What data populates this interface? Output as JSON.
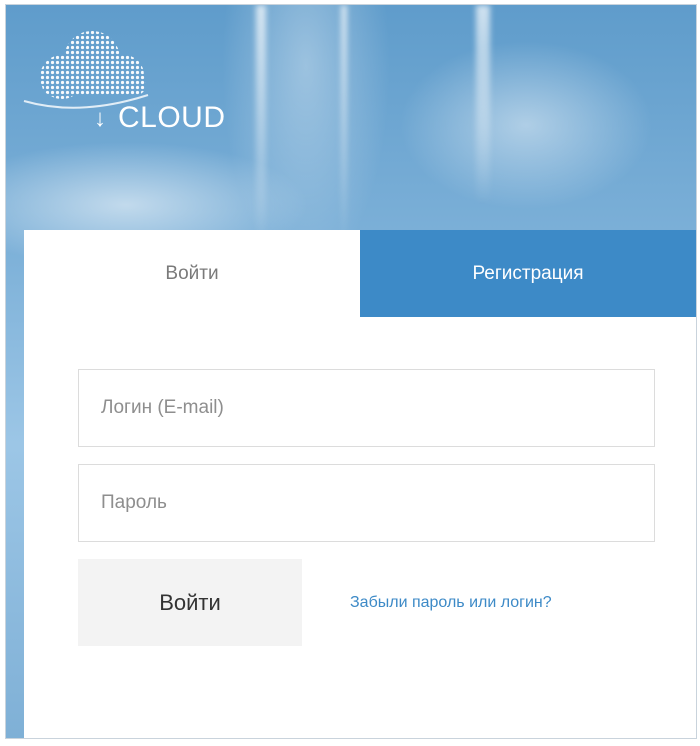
{
  "brand": {
    "logo_text": "CLOUD",
    "accent_color": "#3d8ac7"
  },
  "tabs": [
    {
      "label": "Войти",
      "active": true
    },
    {
      "label": "Регистрация",
      "active": false
    }
  ],
  "form": {
    "login_placeholder": "Логин (E-mail)",
    "login_value": "",
    "password_placeholder": "Пароль",
    "password_value": "",
    "submit_label": "Войти",
    "forgot_link": "Забыли пароль или логин?"
  },
  "icons": {
    "logo": "cloud-dots-icon",
    "download_arrow": "arrow-down-icon"
  }
}
